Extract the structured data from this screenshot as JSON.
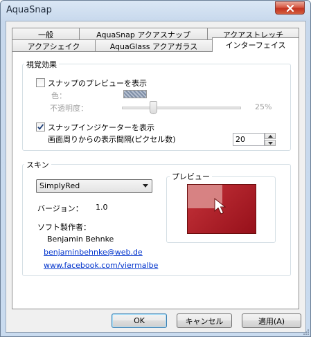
{
  "window": {
    "title": "AquaSnap"
  },
  "tabs": {
    "row1": [
      "一般",
      "AquaSnap アクアスナップ",
      "アクアストレッチ"
    ],
    "row2": [
      "アクアシェイク",
      "AquaGlass アクアガラス",
      "インターフェイス"
    ]
  },
  "visual": {
    "title": "視覚効果",
    "snap_preview_label": "スナップのプレビューを表示",
    "color_label": "色：",
    "opacity_label": "不透明度：",
    "opacity_value": "25%",
    "opacity_fraction": 0.25,
    "snap_indicator_label": "スナップインジケーターを表示",
    "spacing_label": "画面周りからの表示間隔(ピクセル数)",
    "spacing_value": "20"
  },
  "skin": {
    "title": "スキン",
    "selected": "SimplyRed",
    "version_label": "バージョン：",
    "version_value": "1.0",
    "author_label": "ソフト製作者：",
    "author_name": "Benjamin Behnke",
    "email": "benjaminbehnke@web.de",
    "website": "www.facebook.com/viermalbe",
    "preview_label": "プレビュー"
  },
  "buttons": {
    "ok": "OK",
    "cancel": "キャンセル",
    "apply": "適用(A)"
  },
  "colors": {
    "accent": "#3c7fb1",
    "preview_red": "#b01e28",
    "link": "#0033cc"
  },
  "icons": {
    "close": "close-icon",
    "checkmark": "checkmark-icon",
    "cursor": "cursor-arrow-icon"
  }
}
